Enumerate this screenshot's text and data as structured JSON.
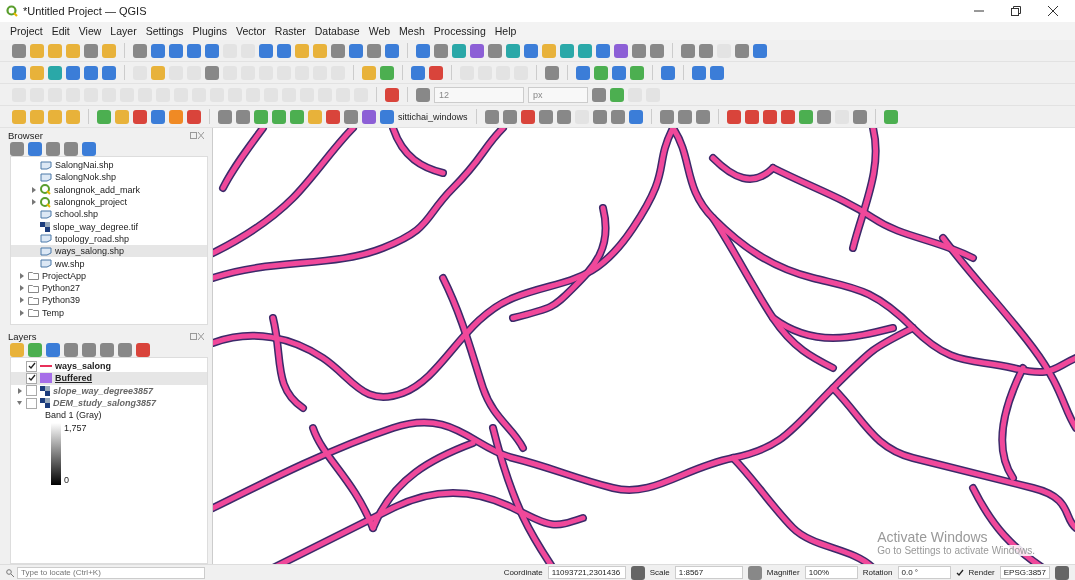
{
  "window": {
    "title": "*Untitled Project — QGIS"
  },
  "menu": [
    "Project",
    "Edit",
    "View",
    "Layer",
    "Settings",
    "Plugins",
    "Vector",
    "Raster",
    "Database",
    "Web",
    "Mesh",
    "Processing",
    "Help"
  ],
  "toolbars": {
    "snapping_tolerance": "12",
    "snapping_unit": "px",
    "user_label": "sittichai_windows"
  },
  "browser": {
    "title": "Browser",
    "items": [
      {
        "label": "SalongNai.shp",
        "kind": "vector",
        "selected": false
      },
      {
        "label": "SalongNok.shp",
        "kind": "vector",
        "selected": false
      },
      {
        "label": "salongnok_add_mark",
        "kind": "project",
        "selected": false,
        "expanded": false
      },
      {
        "label": "salongnok_project",
        "kind": "project",
        "selected": false,
        "expanded": false
      },
      {
        "label": "school.shp",
        "kind": "vector",
        "selected": false
      },
      {
        "label": "slope_way_degree.tif",
        "kind": "raster",
        "selected": false
      },
      {
        "label": "topology_road.shp",
        "kind": "vector",
        "selected": false
      },
      {
        "label": "ways_salong.shp",
        "kind": "vector",
        "selected": true
      },
      {
        "label": "ww.shp",
        "kind": "vector",
        "selected": false
      },
      {
        "label": "ProjectApp",
        "kind": "folder",
        "selected": false,
        "expanded": false
      },
      {
        "label": "Python27",
        "kind": "folder",
        "selected": false,
        "expanded": false
      },
      {
        "label": "Python39",
        "kind": "folder",
        "selected": false,
        "expanded": false
      },
      {
        "label": "Temp",
        "kind": "folder",
        "selected": false,
        "expanded": false
      }
    ]
  },
  "layers": {
    "title": "Layers",
    "items": [
      {
        "label": "ways_salong",
        "kind": "line",
        "checked": true,
        "selected": false,
        "color": "#e8305a"
      },
      {
        "label": "Buffered",
        "kind": "fill",
        "checked": true,
        "selected": true,
        "color": "#a66ee8"
      },
      {
        "label": "slope_way_degree3857",
        "kind": "raster",
        "checked": false,
        "selected": false,
        "expanded": false
      },
      {
        "label": "DEM_study_salong3857",
        "kind": "raster",
        "checked": false,
        "selected": false,
        "expanded": true,
        "legend": {
          "band": "Band 1 (Gray)",
          "max": "1,757",
          "min": "0"
        }
      }
    ]
  },
  "status_bar": {
    "locate_placeholder": "Type to locate (Ctrl+K)",
    "coordinate_label": "Coordinate",
    "coordinate": "11093721,2301436",
    "scale_label": "Scale",
    "scale": "1:8567",
    "magnifier_label": "Magnifier",
    "magnifier": "100%",
    "rotation_label": "Rotation",
    "rotation": "0.0 °",
    "render_label": "Render",
    "render": true,
    "crs": "EPSG:3857"
  },
  "activation": {
    "title": "Activate Windows",
    "hint": "Go to Settings to activate Windows."
  }
}
